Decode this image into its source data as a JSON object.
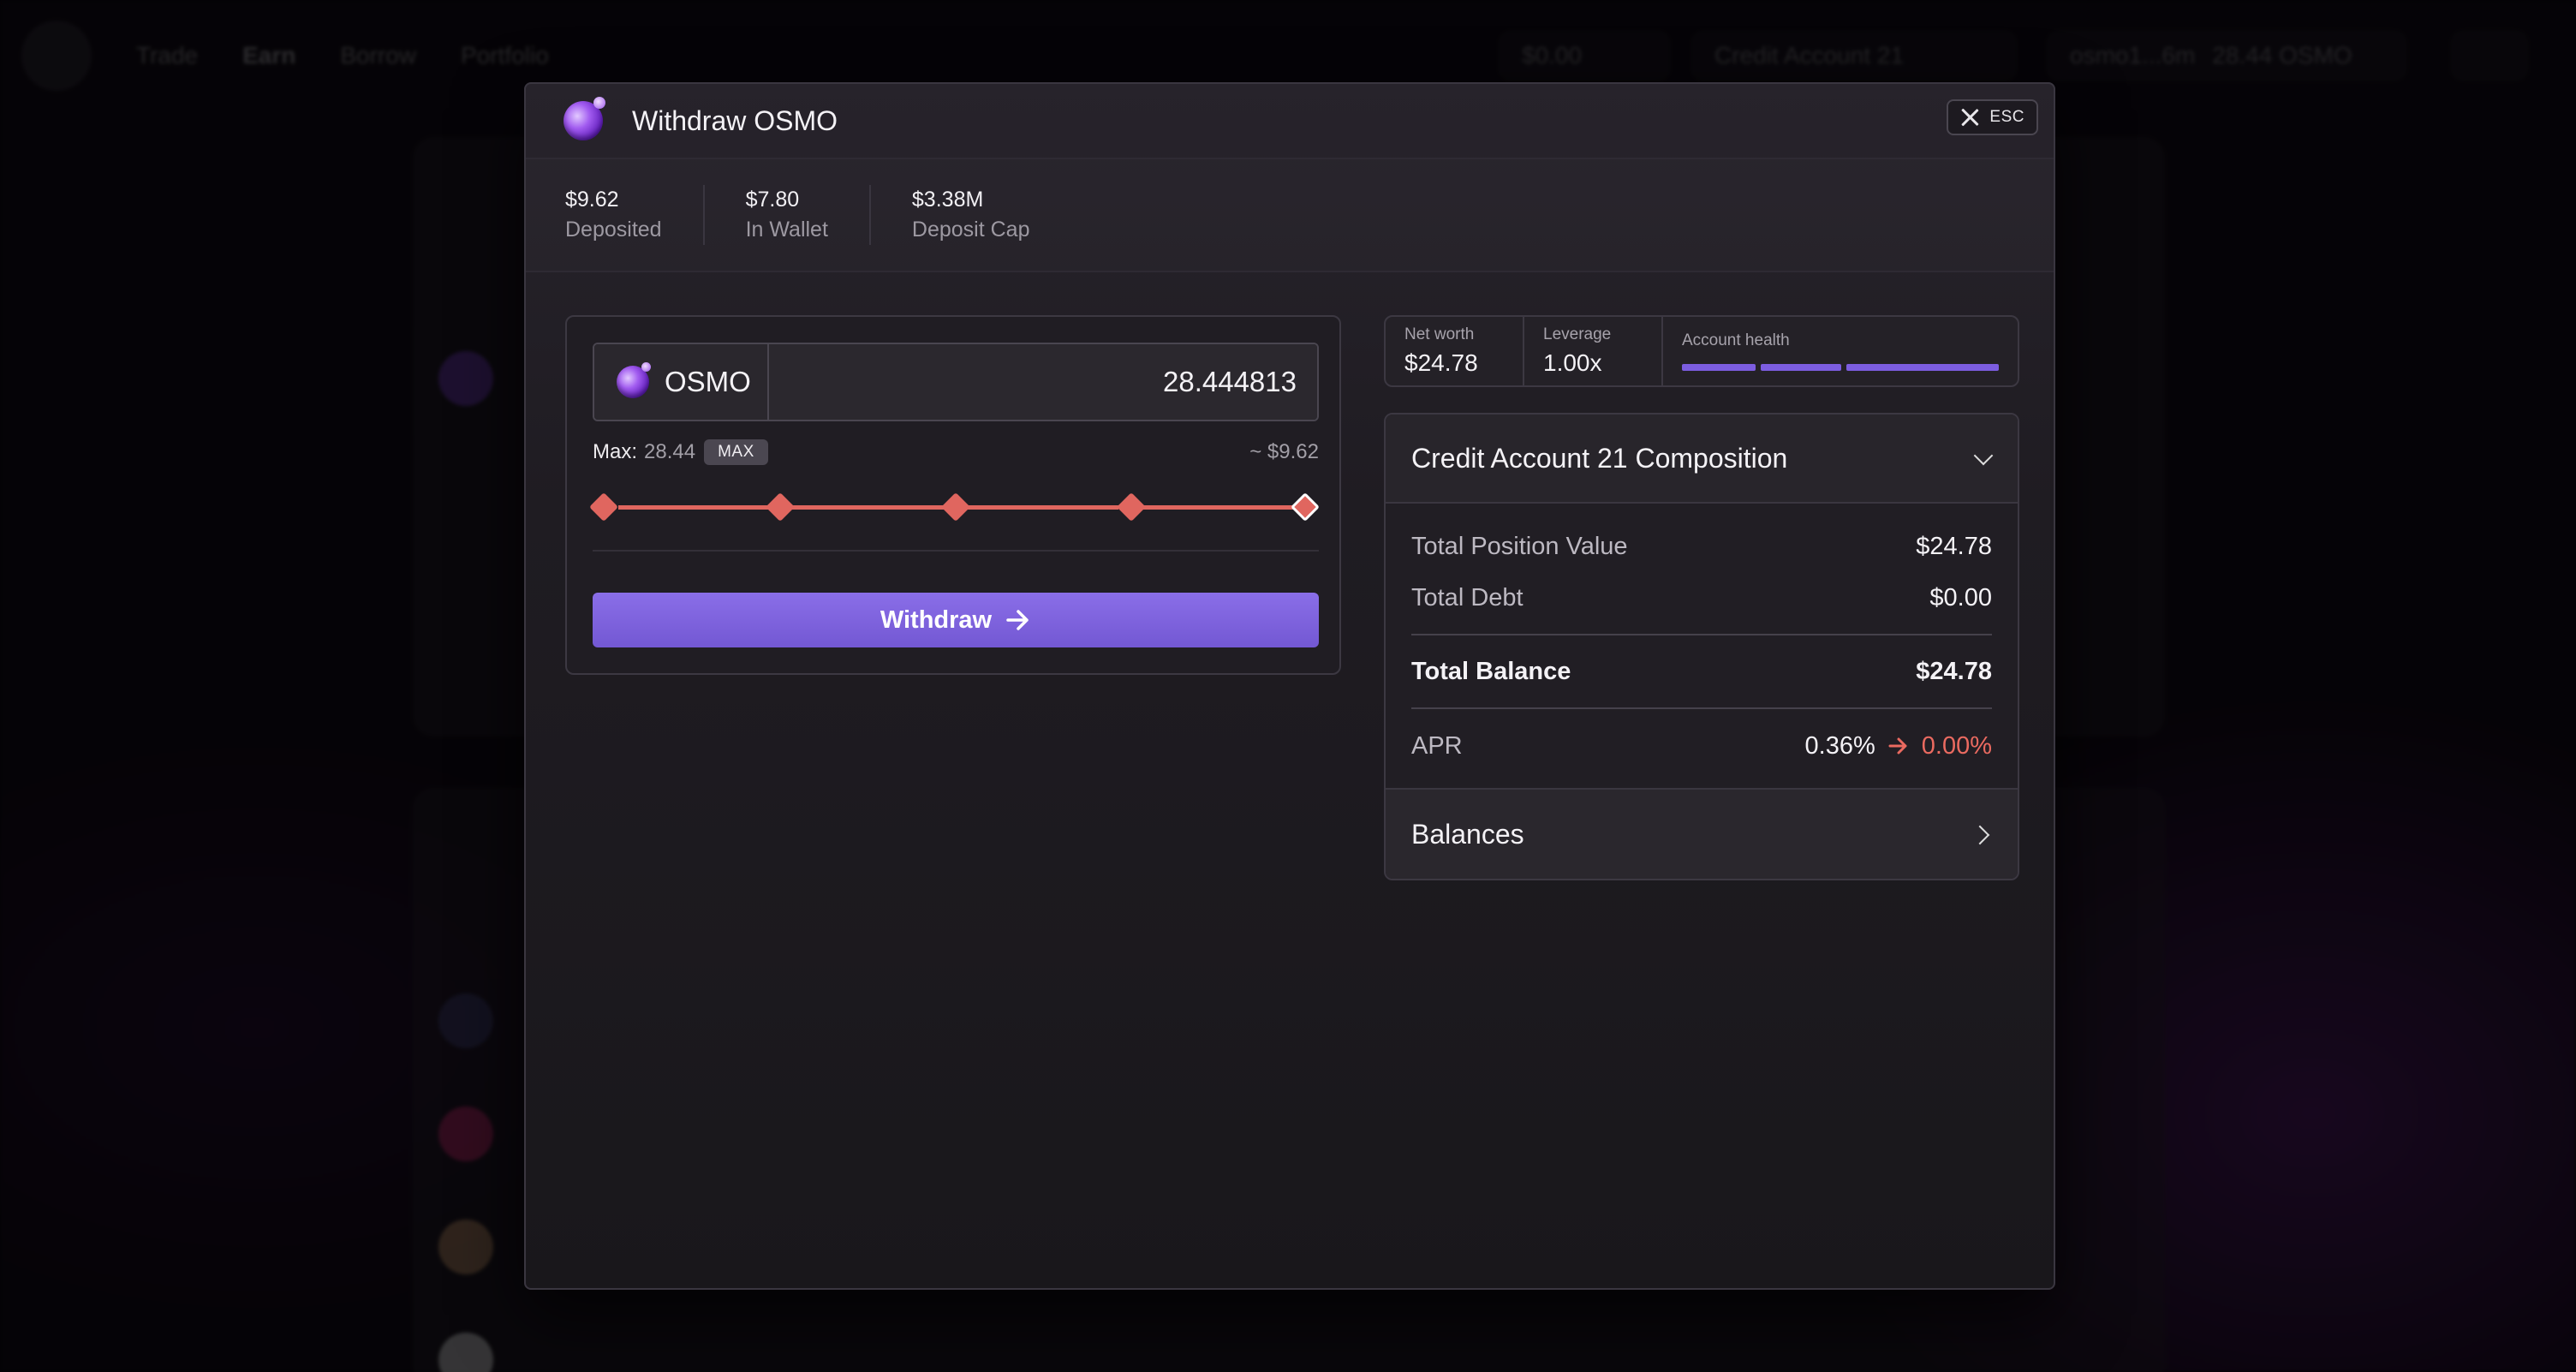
{
  "background": {
    "nav_links": [
      "Trade",
      "Earn",
      "Borrow",
      "Portfolio"
    ],
    "balance_pill": "$0.00",
    "account_pill": "Credit Account 21",
    "wallet_pill": "osmo1...6m",
    "wallet_balance": "28.44 OSMO"
  },
  "modal": {
    "title": "Withdraw OSMO",
    "esc_label": "ESC",
    "stats": [
      {
        "value": "$9.62",
        "label": "Deposited"
      },
      {
        "value": "$7.80",
        "label": "In Wallet"
      },
      {
        "value": "$3.38M",
        "label": "Deposit Cap"
      }
    ],
    "token": "OSMO",
    "amount": "28.444813",
    "max_label": "Max:",
    "max_value": "28.44",
    "max_button": "MAX",
    "usd_approx": "~ $9.62",
    "slider_fraction": 1.0,
    "withdraw_label": "Withdraw",
    "summary": {
      "net_worth_label": "Net worth",
      "net_worth": "$24.78",
      "leverage_label": "Leverage",
      "leverage": "1.00x",
      "health_label": "Account health",
      "health_fraction": 1.0
    },
    "composition": {
      "title": "Credit Account 21 Composition",
      "rows": [
        {
          "label": "Total Position Value",
          "value": "$24.78"
        },
        {
          "label": "Total Debt",
          "value": "$0.00"
        }
      ],
      "total_label": "Total Balance",
      "total_value": "$24.78",
      "apr_label": "APR",
      "apr_current": "0.36%",
      "apr_next": "0.00%",
      "balances_label": "Balances"
    }
  },
  "colors": {
    "accent": "#7c5de0",
    "slider": "#e0665f",
    "apr_next": "#ea6a60"
  }
}
